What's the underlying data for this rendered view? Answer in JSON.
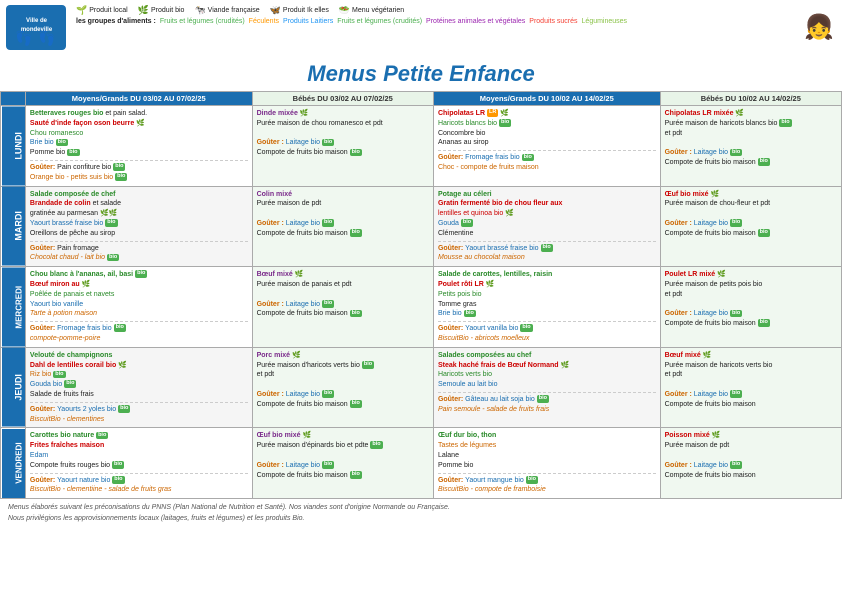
{
  "topBar": {
    "logo": "Ville de\nMondeville",
    "legends": [
      {
        "icon": "🌱",
        "color": "#cc0000",
        "label": "Produit local"
      },
      {
        "icon": "🌿",
        "color": "#4CAF50",
        "label": "Produit bio"
      },
      {
        "icon": "🐄",
        "color": "#1a6eb0",
        "label": "Viande française"
      },
      {
        "icon": "🦋",
        "color": "#e91e8c",
        "label": "Produit Ik elles"
      },
      {
        "icon": "🥗",
        "color": "#4CAF50",
        "label": "Menu végétarien"
      }
    ],
    "foodGroupsLabel": "les groupes d'aliments :",
    "foodGroups": [
      {
        "label": "Fruits et légumes (crudités)",
        "color": "#4CAF50"
      },
      {
        "label": "Féculents",
        "color": "#FF9800"
      },
      {
        "label": "Produits Laitiers",
        "color": "#2196F3"
      },
      {
        "label": "Fruits et légumes (crudités)",
        "color": "#4CAF50"
      },
      {
        "label": "Protéines animales et végétales",
        "color": "#9C27B0"
      },
      {
        "label": "Produits sucrés",
        "color": "#F44336"
      },
      {
        "label": "Légumineuses",
        "color": "#8BC34A"
      }
    ]
  },
  "title": "Menus Petite Enfance",
  "week1": {
    "header": "DU 03/02 AU 07/02/25",
    "headerMG": "Moyens/Grands  DU 03/02 AU 07/02/25",
    "headerBebe": "Bébés   DU 03/02 AU 07/02/25"
  },
  "week2": {
    "headerMG": "Moyens/Grands  DU 10/02 AU 14/02/25",
    "headerBebe": "Bébés   DU 10/02 AU 14/02/25"
  },
  "days": [
    "LUNDI",
    "MARDI",
    "MERCREDI",
    "JEUDI",
    "VENDREDI"
  ],
  "cells": {
    "lundi": {
      "mg1": "Betteraves rouges bio et pain salad.\nSauté d'inde façon oson beurre 🌿\nChou romanesco\nBrie bio 🌿\nPomme bio 🌿\nGoûter: Pain confiture bio 🌿\nOrange bio - petits suis 🌿 🌿",
      "bebe1": "Dinde mixée 🌿\nPurée maison de chou romanesco et pdt\n\nGoûter : Laitage bio 🌿\nCompote de fruits bio maison 🌿",
      "mg2": "Chipolatas LR 🌿\nHaricots blancs bio 🌿\nConcombre bio\nAnanas au sirop\nGoûter: Fromage frais bio 🌿\nChoc - compote de fruits maison",
      "bebe2": "Chipolatas LR mixée 🌿\nPurée maison de haricots blancs bio 🌿\net pdt\n\nGoûter : Laitage bio 🌿\nCompote de fruits bio maison 🌿"
    },
    "mardi": {
      "mg1": "Salade composée de chef\nBrochade de colin et salade\ngratinée au parmesan 🌿🌿\nYaourt brassé fraise bio 🌿\nOreillons de pêche au sirop\nGoûter: Pain fromage\nChocolat chaud - lait bio 🌿",
      "bebe1": "Colin mixé\nPurée maison de pdt\n\nGoûter : Laitage bio 🌿\nCompote de fruits bio maison 🌿",
      "mg2": "Potage au céleri\nGratin fermenté bio de chou fleur aux\nlentilles et quinoa bio 🌿\nGouda 🌿\nClémentine\nGoûter: Yaourt brassé fraise bio 🌿\nMousse au chocolat maison",
      "bebe2": "Œuf bio mixé 🌿\nPurée maison de chou-fleur et pdt\n\nGoûter : Laitage bio 🌿\nCompote de fruits bio maison 🌿"
    },
    "mercredi": {
      "mg1": "Chou blanc à l'ananas, ail, basilic 🌿\nBœuf miron au 🌿\nPoêlée de panais et navets\nYaourt bio vanille\nTarte à la potion maison\nGoûter: Fromage frais bio 🌿\nCompote-pomme-poire",
      "bebe1": "Bœuf mixé 🌿\nPurée maison de panais et pdt\n\nGoûter : Laitage bio 🌿\nCompote de fruits bio maison 🌿",
      "mg2": "Salade de carottes, lentilles, raisin\nPoulet rôti LR 🌿\nPetits pois bio\nTomme gras\nBrie bio 🌿\nGoûter: Yaourt vanilla bio 🌿\nBiscuitBio - abricots moelleux",
      "bebe2": "Poulet LR mixé 🌿\nPurée maison de petits pois bio\net pdt\n\nGoûter : Laitage bio 🌿\nCompote de fruits bio maison 🌿"
    },
    "jeudi": {
      "mg1": "Velouté de champignons\nDahl de lentilles corail bio 🌿\nRiz bio 🌿\nGouda bio 🌿\nSalade de fruits frais\nGoûter: Yaourts 2 yoles bio 🌿\nBiscuitBio - clementines",
      "bebe1": "Porc mixé 🌿\nPurée maison d'haricots verts bio 🌿\net pdt\n\nGoûter : Laitage bio 🌿\nCompote de fruits bio maison 🌿",
      "mg2": "Salades composées au chef\nSteak haché frais de Bœuf Normand 🌿\nHaricots verts bio\nSemoule au lait bio\nGoûter: Gâteau au lait soja bio 🌿\nPain semoule - salade de fruits frais",
      "bebe2": "Bœuf mixé 🌿\nPurée maison de haricots verts bio\net pdt\n\nGoûter : Laitage bio 🌿\nCompote de fruits bio maison"
    },
    "vendredi": {
      "mg1": "Carottes bio nature 🌿\nFrites fraîches maison\nEdam\nCompote fruits rouges bio 🌿\nGoûter: Yaourt nature bio 🌿\nBiscuitBio - clementiine - salade de fruits gras",
      "bebe1": "Œuf bio mixé 🌿\nPurée maison d'épinards bio et pdte 🌿\n\nGoûter : Laitage bio 🌿\nCompote de fruits bio maison 🌿",
      "mg2": "Œuf dur bio, thon\nTastes de légumes\nLalane\nPomme bio\nGoûter: Yaourt mangue bio 🌿\nBiscuitBio - compote de framboisie",
      "bebe2": "Poisson mixé 🌿\nPurée maison de pdt\n\nGoûter : Laitage bio 🌿\nCompote de fruits bio maison"
    }
  },
  "footer": {
    "line1": "Menus élaborés suivant les préconisations du PNNS (Plan National de Nutrition et Santé). Nos viandes sont d'origine Normande ou Française.",
    "line2": "Nous privilégions les approvisionnements locaux (laitages, fruits et légumes) et les produits Bio."
  }
}
